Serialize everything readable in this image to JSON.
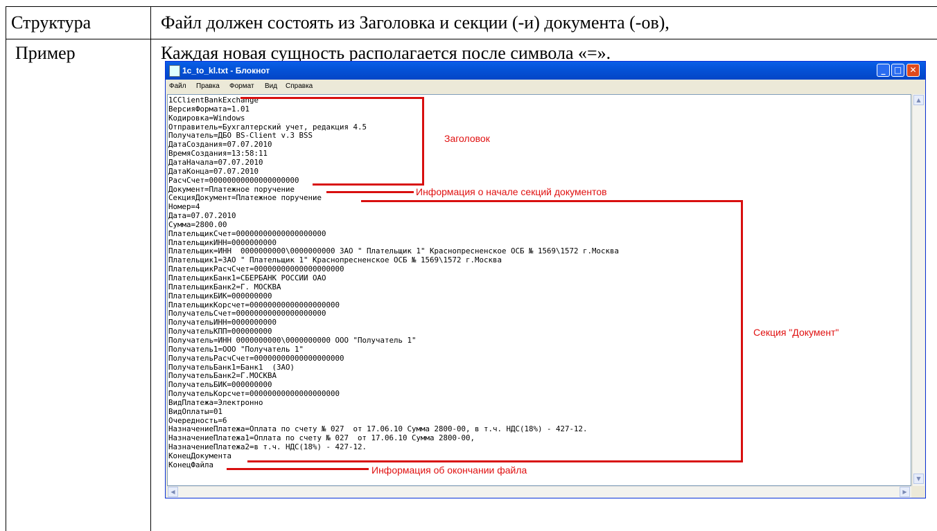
{
  "table": {
    "row1_label": "Структура",
    "row1_value": "Файл должен состоять из Заголовка и секции (-и) документа (-ов),",
    "row2_label": "Пример",
    "row2_value": "Каждая новая сущность располагается после символа «=»."
  },
  "notepad": {
    "title": "1c_to_kl.txt - Блокнот",
    "menu": [
      "Файл",
      "Правка",
      "Формат",
      "Вид",
      "Справка"
    ],
    "lines": [
      "1CClientBankExchange",
      "ВерсияФормата=1.01",
      "Кодировка=Windows",
      "Отправитель=Бухгалтерский учет, редакция 4.5",
      "Получатель=ДБО BS-Client v.3 BSS",
      "ДатаСоздания=07.07.2010",
      "ВремяСоздания=13:58:11",
      "ДатаНачала=07.07.2010",
      "ДатаКонца=07.07.2010",
      "РасчСчет=00000000000000000000",
      "Документ=Платежное поручение",
      "СекцияДокумент=Платежное поручение",
      "Номер=4",
      "Дата=07.07.2010",
      "Сумма=2800.00",
      "ПлательщикСчет=00000000000000000000",
      "ПлательщикИНН=0000000000",
      "Плательщик=ИНН  0000000000\\0000000000 ЗАО \" Плательщик 1\" Краснопресненское ОСБ № 1569\\1572 г.Москва",
      "Плательщик1=ЗАО \" Плательщик 1\" Краснопресненское ОСБ № 1569\\1572 г.Москва",
      "ПлательщикРасчСчет=00000000000000000000",
      "ПлательщикБанк1=СБЕРБАНК РОССИИ ОАО",
      "ПлательщикБанк2=Г. МОСКВА",
      "ПлательщикБИК=000000000",
      "ПлательщикКорсчет=00000000000000000000",
      "ПолучательСчет=00000000000000000000",
      "ПолучательИНН=0000000000",
      "ПолучательКПП=000000000",
      "Получатель=ИНН 0000000000\\0000000000 ООО \"Получатель 1\"",
      "Получатель1=ООО \"Получатель 1\"",
      "ПолучательРасчСчет=00000000000000000000",
      "ПолучательБанк1=Банк1  (ЗАО)",
      "ПолучательБанк2=Г.МОСКВА",
      "ПолучательБИК=000000000",
      "ПолучательКорсчет=00000000000000000000",
      "ВидПлатежа=Электронно",
      "ВидОплаты=01",
      "Очередность=6",
      "НазначениеПлатежа=Оплата по счету № 027  от 17.06.10 Сумма 2800-00, в т.ч. НДС(18%) - 427-12.",
      "НазначениеПлатежа1=Оплата по счету № 027  от 17.06.10 Сумма 2800-00,",
      "НазначениеПлатежа2=в т.ч. НДС(18%) - 427-12.",
      "КонецДокумента",
      "КонецФайла"
    ],
    "annotations": {
      "header": "Заголовок",
      "sections_start": "Информация о начале секций документов",
      "document_section": "Секция \"Документ\"",
      "file_end": "Информация об окончании файла"
    }
  },
  "colors": {
    "annotation": "#e01010",
    "titlebar": "#0453d8"
  }
}
